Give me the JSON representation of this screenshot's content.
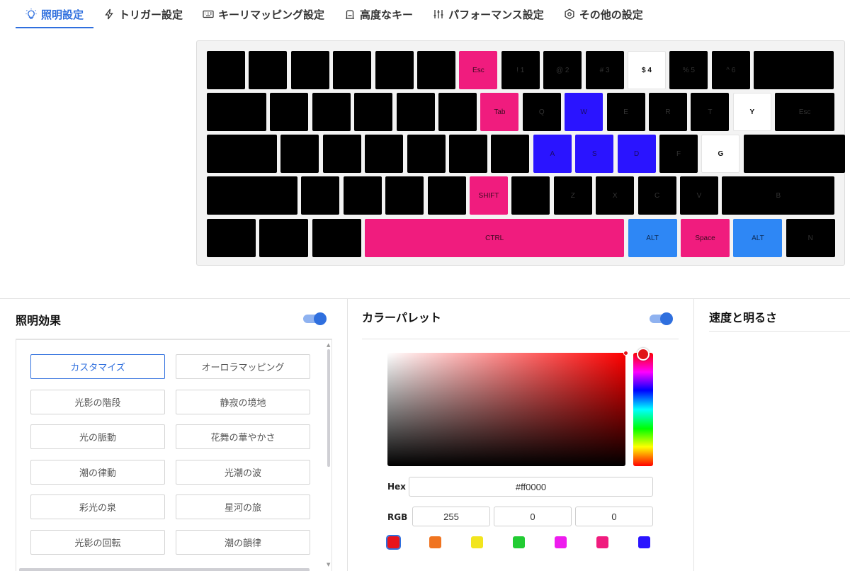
{
  "tabs": [
    {
      "label": "照明設定",
      "icon": "bulb-icon",
      "active": true
    },
    {
      "label": "トリガー設定",
      "icon": "lightning-icon",
      "active": false
    },
    {
      "label": "キーリマッピング設定",
      "icon": "keyboard-icon",
      "active": false
    },
    {
      "label": "高度なキー",
      "icon": "advanced-key-icon",
      "active": false
    },
    {
      "label": "パフォーマンス設定",
      "icon": "sliders-icon",
      "active": false
    },
    {
      "label": "その他の設定",
      "icon": "gear-icon",
      "active": false
    }
  ],
  "keyboard": {
    "colors": {
      "black": "#000000",
      "pink": "#f01c7e",
      "blue": "#2a14ff",
      "light_blue": "#2e87f5",
      "white": "#ffffff"
    },
    "rows": [
      [
        {
          "l": "",
          "c": "black"
        },
        {
          "l": "",
          "c": "black"
        },
        {
          "l": "",
          "c": "black"
        },
        {
          "l": "",
          "c": "black"
        },
        {
          "l": "",
          "c": "black"
        },
        {
          "l": "",
          "c": "black"
        },
        {
          "l": "Esc",
          "c": "pink"
        },
        {
          "l": "! 1",
          "c": "black"
        },
        {
          "l": "@ 2",
          "c": "black"
        },
        {
          "l": "# 3",
          "c": "black"
        },
        {
          "l": "$ 4",
          "c": "white"
        },
        {
          "l": "% 5",
          "c": "black"
        },
        {
          "l": "^ 6",
          "c": "black"
        },
        {
          "l": "",
          "c": "black"
        }
      ],
      [
        {
          "l": "",
          "c": "black"
        },
        {
          "l": "",
          "c": "black"
        },
        {
          "l": "",
          "c": "black"
        },
        {
          "l": "",
          "c": "black"
        },
        {
          "l": "",
          "c": "black"
        },
        {
          "l": "",
          "c": "black"
        },
        {
          "l": "Tab",
          "c": "pink"
        },
        {
          "l": "Q",
          "c": "black"
        },
        {
          "l": "W",
          "c": "blue"
        },
        {
          "l": "E",
          "c": "black"
        },
        {
          "l": "R",
          "c": "black"
        },
        {
          "l": "T",
          "c": "black"
        },
        {
          "l": "Y",
          "c": "white"
        },
        {
          "l": "Esc",
          "c": "black"
        }
      ],
      [
        {
          "l": "",
          "c": "black"
        },
        {
          "l": "",
          "c": "black"
        },
        {
          "l": "",
          "c": "black"
        },
        {
          "l": "",
          "c": "black"
        },
        {
          "l": "",
          "c": "black"
        },
        {
          "l": "",
          "c": "black"
        },
        {
          "l": "",
          "c": "black"
        },
        {
          "l": "A",
          "c": "blue"
        },
        {
          "l": "S",
          "c": "blue"
        },
        {
          "l": "D",
          "c": "blue"
        },
        {
          "l": "F",
          "c": "black"
        },
        {
          "l": "G",
          "c": "white"
        },
        {
          "l": "",
          "c": "black"
        }
      ],
      [
        {
          "l": "",
          "c": "black"
        },
        {
          "l": "",
          "c": "black"
        },
        {
          "l": "",
          "c": "black"
        },
        {
          "l": "",
          "c": "black"
        },
        {
          "l": "",
          "c": "black"
        },
        {
          "l": "SHIFT",
          "c": "pink"
        },
        {
          "l": "",
          "c": "black"
        },
        {
          "l": "Z",
          "c": "black"
        },
        {
          "l": "X",
          "c": "black"
        },
        {
          "l": "C",
          "c": "black"
        },
        {
          "l": "V",
          "c": "black"
        },
        {
          "l": "B",
          "c": "black"
        }
      ],
      [
        {
          "l": "",
          "c": "black"
        },
        {
          "l": "",
          "c": "black"
        },
        {
          "l": "",
          "c": "black"
        },
        {
          "l": "CTRL",
          "c": "pink"
        },
        {
          "l": "ALT",
          "c": "light_blue"
        },
        {
          "l": "Space",
          "c": "pink"
        },
        {
          "l": "ALT",
          "c": "light_blue"
        },
        {
          "l": "N",
          "c": "black"
        }
      ]
    ]
  },
  "lighting_panel": {
    "title": "照明効果",
    "toggle_on": true,
    "effects": [
      "カスタマイズ",
      "オーロラマッピング",
      "光影の階段",
      "静寂の境地",
      "光の脈動",
      "花舞の華やかさ",
      "潮の律動",
      "光潮の波",
      "彩光の泉",
      "星河の旅",
      "光影の回転",
      "潮の韻律"
    ],
    "selected_effect": "カスタマイズ"
  },
  "color_panel": {
    "title": "カラーパレット",
    "toggle_on": true,
    "hex_label": "Hex",
    "hex_value": "#ff0000",
    "rgb_label": "RGB",
    "rgb": [
      "255",
      "0",
      "0"
    ],
    "swatches": [
      "#e8141c",
      "#f07420",
      "#f2e51e",
      "#22cc33",
      "#ee1cee",
      "#f01c7e",
      "#2a14ff"
    ],
    "selected_swatch": 0
  },
  "speed_panel": {
    "title": "速度と明るさ"
  }
}
